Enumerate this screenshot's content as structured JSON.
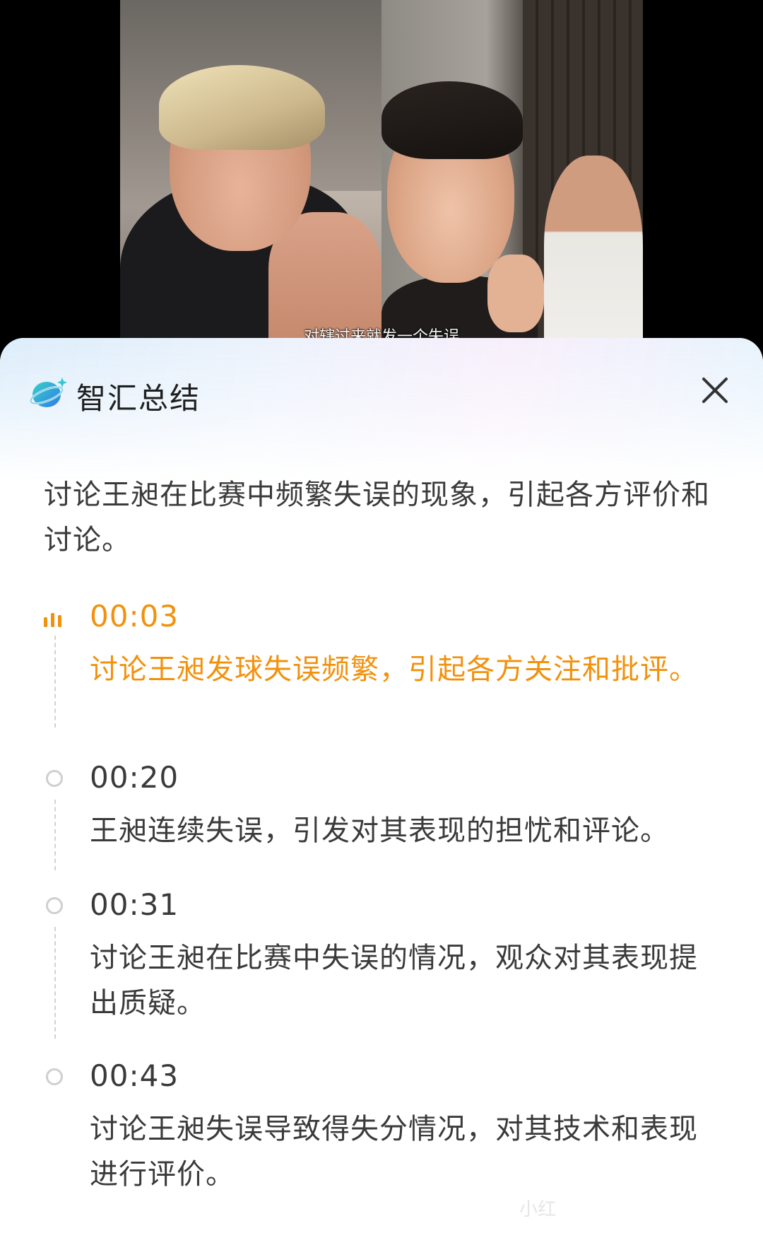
{
  "video": {
    "subtitle": "对辖过来就发一个失误"
  },
  "panel": {
    "title": "智汇总结",
    "logo_icon": "zhihui-logo-icon",
    "close_icon": "close-icon",
    "summary": "讨论王昶在比赛中频繁失误的现象，引起各方评价和讨论。"
  },
  "timeline": [
    {
      "time": "00:03",
      "text": "讨论王昶发球失误频繁，引起各方关注和批评。",
      "active": true
    },
    {
      "time": "00:20",
      "text": "王昶连续失误，引发对其表现的担忧和评论。",
      "active": false
    },
    {
      "time": "00:31",
      "text": "讨论王昶在比赛中失误的情况，观众对其表现提出质疑。",
      "active": false
    },
    {
      "time": "00:43",
      "text": "讨论王昶失误导致得失分情况，对其技术和表现进行评价。",
      "active": false
    }
  ],
  "watermark": "小红",
  "colors": {
    "accent": "#f2910c",
    "text": "#3a3a3a",
    "inactive_marker": "#cfcfcf"
  }
}
